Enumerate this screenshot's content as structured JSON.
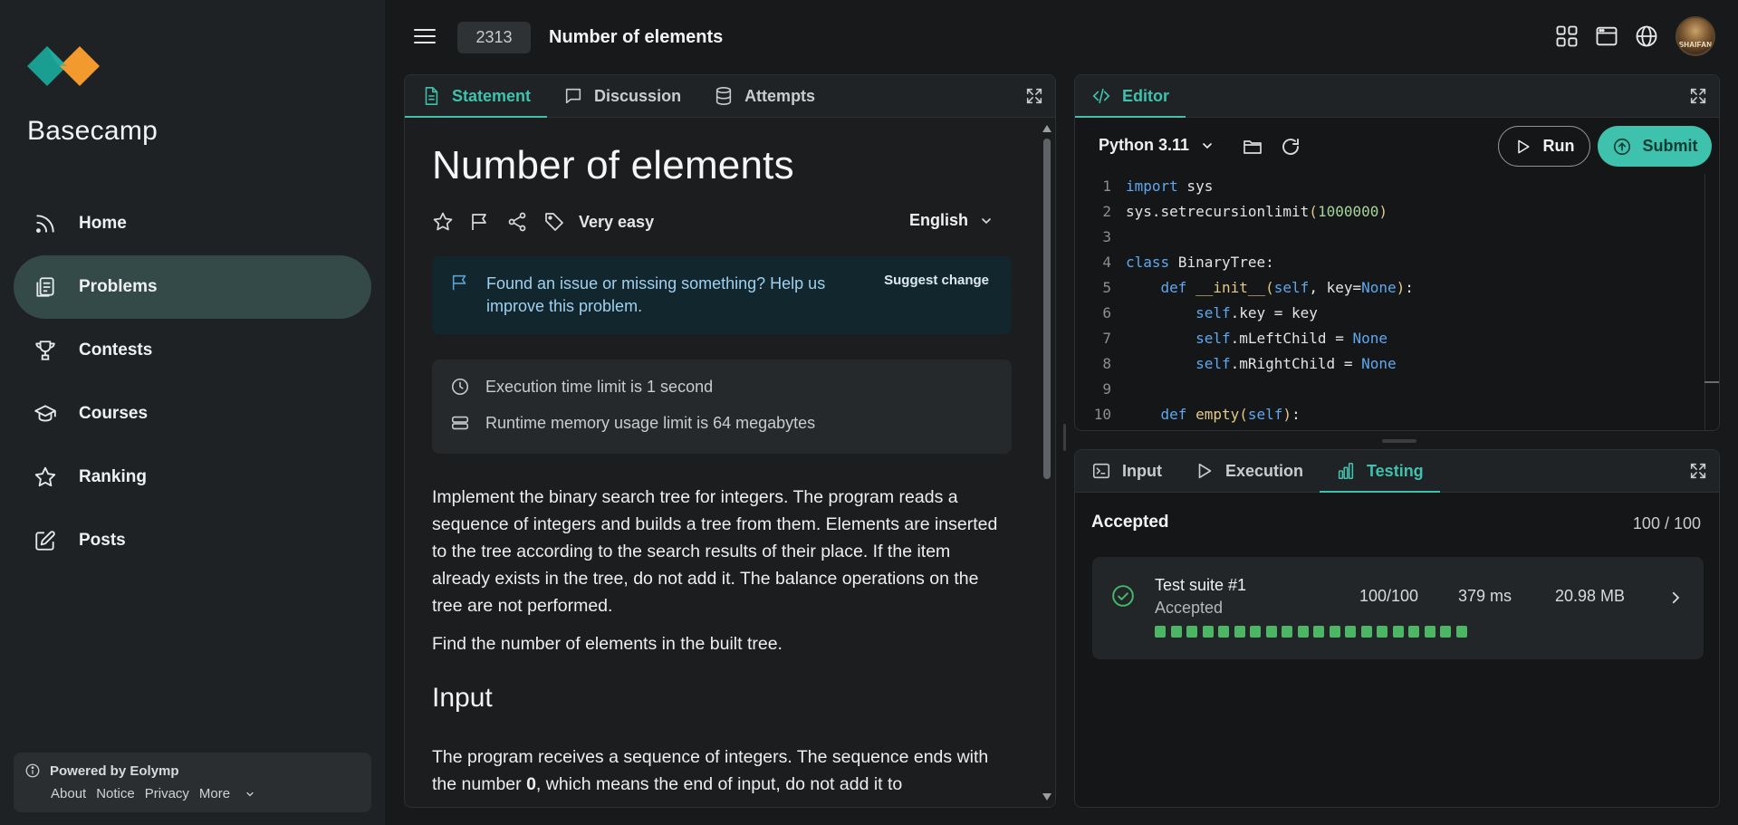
{
  "sidebar": {
    "brand": "Basecamp",
    "nav": [
      {
        "label": "Home",
        "icon": "rss-icon"
      },
      {
        "label": "Problems",
        "icon": "clipboard-icon",
        "active": true
      },
      {
        "label": "Contests",
        "icon": "trophy-icon"
      },
      {
        "label": "Courses",
        "icon": "graduation-cap-icon"
      },
      {
        "label": "Ranking",
        "icon": "star-icon"
      },
      {
        "label": "Posts",
        "icon": "edit-icon"
      }
    ],
    "footer": {
      "powered_by": "Powered by Eolymp",
      "links": [
        "About",
        "Notice",
        "Privacy",
        "More"
      ]
    }
  },
  "topbar": {
    "problem_id": "2313",
    "title": "Number of elements",
    "avatar_text": "SHAIFAN"
  },
  "statement_panel": {
    "tabs": [
      {
        "label": "Statement",
        "icon": "document-icon",
        "active": true
      },
      {
        "label": "Discussion",
        "icon": "chat-icon"
      },
      {
        "label": "Attempts",
        "icon": "database-icon"
      }
    ],
    "title": "Number of elements",
    "difficulty": "Very easy",
    "language": "English",
    "issue": {
      "text": "Found an issue or missing something? Help us improve this problem.",
      "action": "Suggest change"
    },
    "limits": {
      "time": "Execution time limit is 1 second",
      "memory": "Runtime memory usage limit is 64 megabytes"
    },
    "paragraphs": [
      "Implement the binary search tree for integers. The program reads a sequence of integers and builds a tree from them. Elements are inserted to the tree according to the search results of their place. If the item already exists in the tree, do not add it. The balance operations on the tree are not performed.",
      "Find the number of elements in the built tree."
    ],
    "input_heading": "Input",
    "input_text_1": "The program receives a sequence of integers. The sequence ends with the number ",
    "input_bold": "0",
    "input_text_2": ", which means the end of input, do not add it to"
  },
  "editor_panel": {
    "tab": "Editor",
    "language": "Python 3.11",
    "run_label": "Run",
    "submit_label": "Submit",
    "code_lines": [
      "import sys",
      "sys.setrecursionlimit(1000000)",
      "",
      "class BinaryTree:",
      "    def __init__(self, key=None):",
      "        self.key = key",
      "        self.mLeftChild = None",
      "        self.mRightChild = None",
      "",
      "    def empty(self):"
    ]
  },
  "testing_panel": {
    "tabs": [
      {
        "label": "Input",
        "icon": "terminal-icon"
      },
      {
        "label": "Execution",
        "icon": "play-icon"
      },
      {
        "label": "Testing",
        "icon": "bar-chart-icon",
        "active": true
      }
    ],
    "verdict": "Accepted",
    "score": "100 / 100",
    "suites": [
      {
        "name": "Test suite #1",
        "status": "Accepted",
        "score": "100/100",
        "time": "379 ms",
        "memory": "20.98 MB",
        "tests_passed": 20
      }
    ]
  },
  "colors": {
    "accent": "#3fc2ad",
    "active_nav": "#334a48",
    "pass_green": "#4cb664"
  }
}
